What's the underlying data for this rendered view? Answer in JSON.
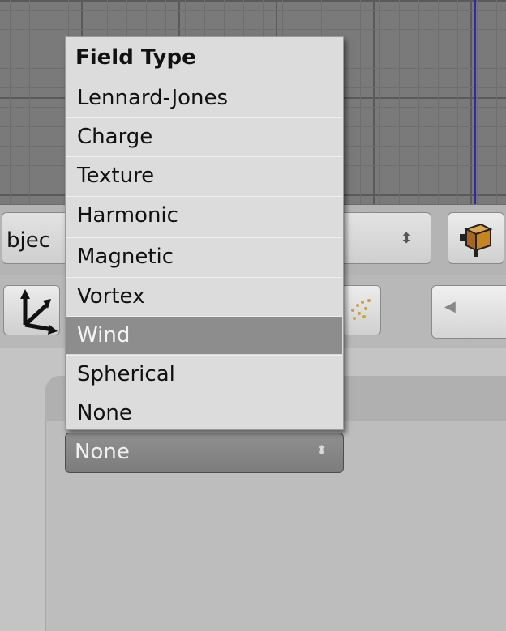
{
  "header": {
    "object_label": "bjec",
    "object_arrows": "⬍"
  },
  "popup": {
    "title": "Field Type",
    "items": [
      {
        "label": "Lennard-Jones"
      },
      {
        "label": "Charge"
      },
      {
        "label": "Texture"
      },
      {
        "label": "Harmonic"
      },
      {
        "label": "Magnetic"
      },
      {
        "label": "Vortex"
      },
      {
        "label": "Wind",
        "selected": true
      },
      {
        "label": "Spherical"
      },
      {
        "label": "None"
      }
    ]
  },
  "field_select": {
    "value": "None",
    "arrows": "⬍"
  },
  "nav": {
    "arrow": "◀"
  },
  "colors": {
    "viewport_axis": "#2c2ca8",
    "menu_selected": "#8d8d8d",
    "icon_orange": "#c8851e"
  }
}
